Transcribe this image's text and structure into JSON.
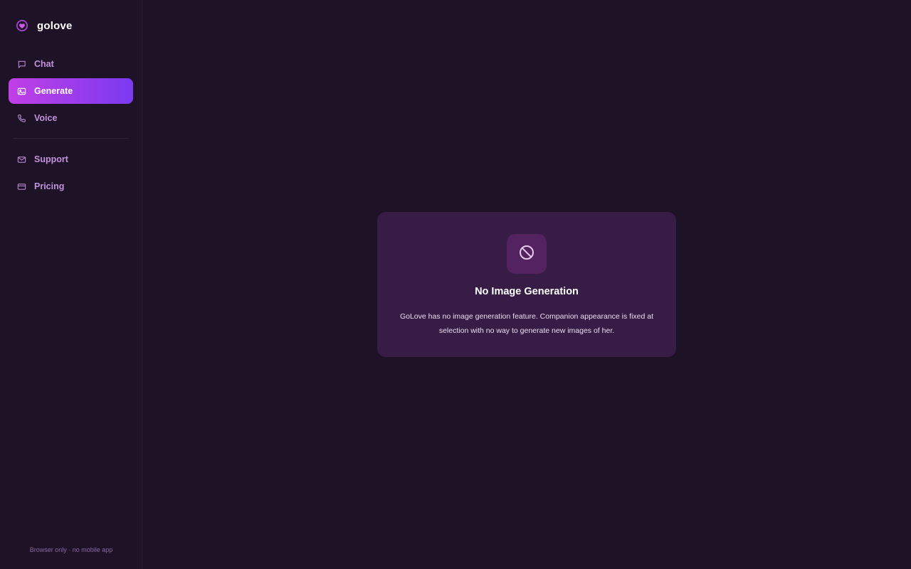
{
  "brand": {
    "name": "golove",
    "logo_icon": "heart-badge-icon"
  },
  "sidebar": {
    "primary_items": [
      {
        "label": "Chat",
        "icon": "chat-bubble-icon",
        "active": false
      },
      {
        "label": "Generate",
        "icon": "image-icon",
        "active": true
      },
      {
        "label": "Voice",
        "icon": "phone-icon",
        "active": false
      }
    ],
    "secondary_items": [
      {
        "label": "Support",
        "icon": "mail-icon",
        "active": false
      },
      {
        "label": "Pricing",
        "icon": "credit-card-icon",
        "active": false
      }
    ],
    "footer": "Browser only · no mobile app"
  },
  "notice": {
    "icon": "no-entry-icon",
    "title": "No Image Generation",
    "text": "GoLove has no image generation feature. Companion appearance is fixed at selection with no way to generate new images of her."
  },
  "colors": {
    "background": "#1e1226",
    "accent_gradient_start": "#c13fe6",
    "accent_gradient_end": "#7b3af0",
    "nav_text": "#c293dc",
    "card_bg": "#371c45"
  }
}
